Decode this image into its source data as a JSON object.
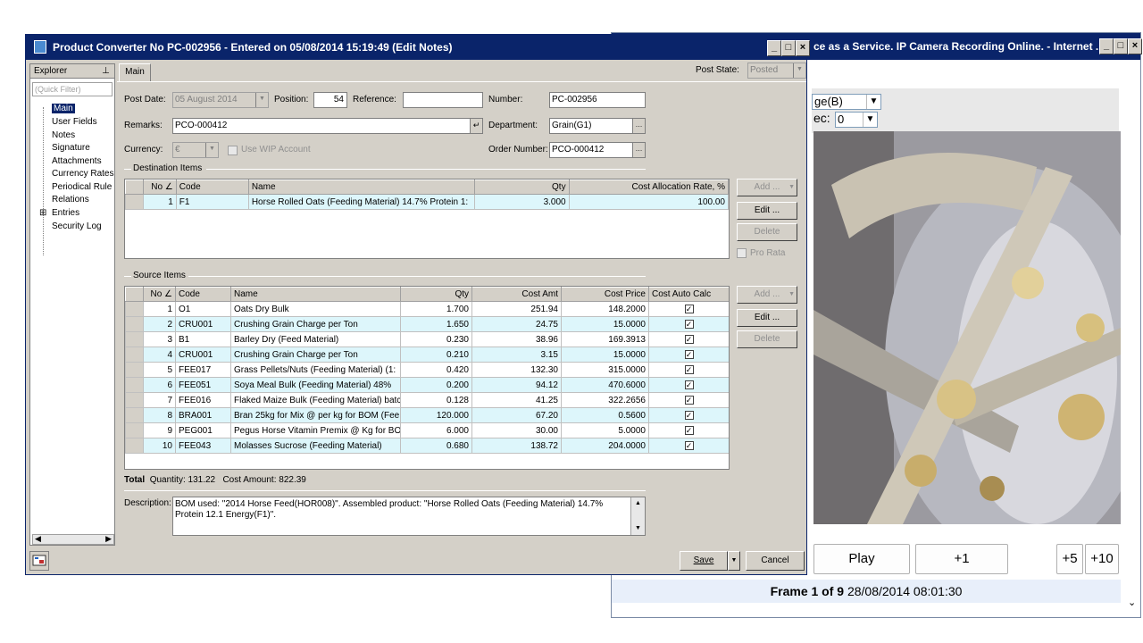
{
  "ie_window": {
    "title": "ce as a Service. IP Camera Recording Online. - Internet ...",
    "select_a": "ge(B)",
    "select_b_label": "ec:",
    "select_b_value": "0",
    "buttons": [
      "Play",
      "+1",
      "+5",
      "+10"
    ],
    "frame_prefix": "Frame 1 of 9",
    "frame_time": "28/08/2014 08:01:30"
  },
  "window": {
    "title": "Product Converter No PC-002956 - Entered on 05/08/2014 15:19:49 (Edit Notes)"
  },
  "explorer": {
    "header": "Explorer",
    "pin": "⊥",
    "quick_filter_placeholder": "(Quick Filter)",
    "items": [
      "Main",
      "User Fields",
      "Notes",
      "Signature",
      "Attachments",
      "Currency Rates",
      "Periodical Rule",
      "Relations",
      "Entries",
      "Security Log"
    ],
    "expand_symbol": "⊞"
  },
  "form": {
    "tab": "Main",
    "post_state_label": "Post State:",
    "post_state_value": "Posted",
    "post_date_label": "Post Date:",
    "post_date_value": "05   August   2014",
    "position_label": "Position:",
    "position_value": "54",
    "reference_label": "Reference:",
    "reference_value": "",
    "number_label": "Number:",
    "number_value": "PC-002956",
    "remarks_label": "Remarks:",
    "remarks_value": "PCO-000412",
    "department_label": "Department:",
    "department_value": "Grain(G1)",
    "currency_label": "Currency:",
    "currency_value": "€",
    "use_wip_label": "Use WIP Account",
    "order_number_label": "Order Number:",
    "order_number_value": "PCO-000412"
  },
  "destination": {
    "group_label": "Destination Items",
    "columns": [
      "No ∠",
      "Code",
      "Name",
      "Qty",
      "Cost Allocation Rate, %"
    ],
    "rows": [
      {
        "no": "1",
        "code": "F1",
        "name": "Horse Rolled Oats (Feeding Material)  14.7% Protein  1:",
        "qty": "3.000",
        "rate": "100.00"
      }
    ],
    "buttons": {
      "add": "Add ...",
      "edit": "Edit ...",
      "delete": "Delete",
      "pro_rata": "Pro Rata"
    }
  },
  "source": {
    "group_label": "Source Items",
    "columns": [
      "No ∠",
      "Code",
      "Name",
      "Qty",
      "Cost Amt",
      "Cost Price",
      "Cost Auto Calc"
    ],
    "rows": [
      {
        "no": "1",
        "code": "O1",
        "name": "Oats Dry Bulk",
        "qty": "1.700",
        "amt": "251.94",
        "price": "148.2000"
      },
      {
        "no": "2",
        "code": "CRU001",
        "name": "Crushing Grain Charge per Ton",
        "qty": "1.650",
        "amt": "24.75",
        "price": "15.0000"
      },
      {
        "no": "3",
        "code": "B1",
        "name": "Barley Dry (Feed Material)",
        "qty": "0.230",
        "amt": "38.96",
        "price": "169.3913"
      },
      {
        "no": "4",
        "code": "CRU001",
        "name": "Crushing Grain Charge per Ton",
        "qty": "0.210",
        "amt": "3.15",
        "price": "15.0000"
      },
      {
        "no": "5",
        "code": "FEE017",
        "name": "Grass Pellets/Nuts  (Feeding Material)  (1:",
        "qty": "0.420",
        "amt": "132.30",
        "price": "315.0000"
      },
      {
        "no": "6",
        "code": "FEE051",
        "name": "Soya Meal Bulk   (Feeding Material)   48%",
        "qty": "0.200",
        "amt": "94.12",
        "price": "470.6000"
      },
      {
        "no": "7",
        "code": "FEE016",
        "name": "Flaked Maize Bulk  (Feeding Material) batch",
        "qty": "0.128",
        "amt": "41.25",
        "price": "322.2656"
      },
      {
        "no": "8",
        "code": "BRA001",
        "name": "Bran 25kg  for Mix @ per kg for BOM   (Fee",
        "qty": "120.000",
        "amt": "67.20",
        "price": "0.5600"
      },
      {
        "no": "9",
        "code": "PEG001",
        "name": "Pegus Horse  Vitamin Premix @ Kg for BOM",
        "qty": "6.000",
        "amt": "30.00",
        "price": "5.0000"
      },
      {
        "no": "10",
        "code": "FEE043",
        "name": "Molasses Sucrose   (Feeding Material)",
        "qty": "0.680",
        "amt": "138.72",
        "price": "204.0000"
      }
    ],
    "buttons": {
      "add": "Add ...",
      "edit": "Edit ...",
      "delete": "Delete"
    }
  },
  "totals": {
    "label": "Total",
    "quantity": "Quantity: 131.22",
    "cost": "Cost Amount: 822.39"
  },
  "description": {
    "label": "Description:",
    "text": "BOM used: \"2014 Horse Feed(HOR008)\". Assembled product: \"Horse Rolled Oats (Feeding Material)  14.7% Protein  12.1 Energy(F1)\"."
  },
  "footer": {
    "save": "Save",
    "cancel": "Cancel"
  }
}
